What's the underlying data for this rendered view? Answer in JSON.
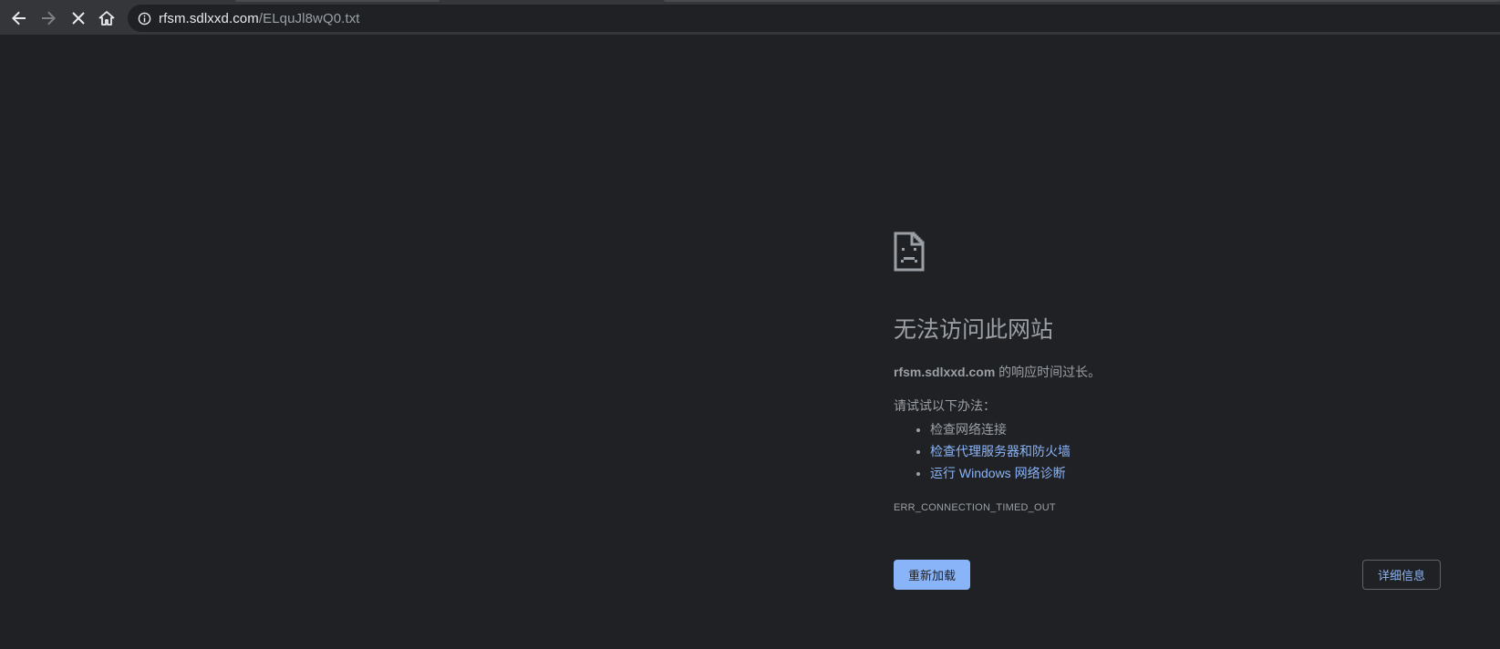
{
  "browser": {
    "url_host": "rfsm.sdlxxd.com",
    "url_path": "/ELquJl8wQ0.txt",
    "icons": {
      "back": "back-arrow-icon",
      "forward": "forward-arrow-icon",
      "stop": "close-icon",
      "home": "home-icon",
      "site_info": "info-icon"
    }
  },
  "error_page": {
    "icon": "sad-page-icon",
    "title": "无法访问此网站",
    "summary_host": "rfsm.sdlxxd.com",
    "summary_text": " 的响应时间过长。",
    "suggest_heading": "请试试以下办法：",
    "suggestions": [
      {
        "label": "检查网络连接",
        "is_link": false
      },
      {
        "label": "检查代理服务器和防火墙",
        "is_link": true
      },
      {
        "label": "运行 Windows 网络诊断",
        "is_link": true
      }
    ],
    "error_code": "ERR_CONNECTION_TIMED_OUT",
    "reload_label": "重新加载",
    "details_label": "详细信息"
  },
  "colors": {
    "page_bg": "#202124",
    "toolbar_bg": "#35363a",
    "text_secondary": "#9aa0a6",
    "link": "#8ab4f8",
    "button_primary_bg": "#8ab4f8"
  }
}
